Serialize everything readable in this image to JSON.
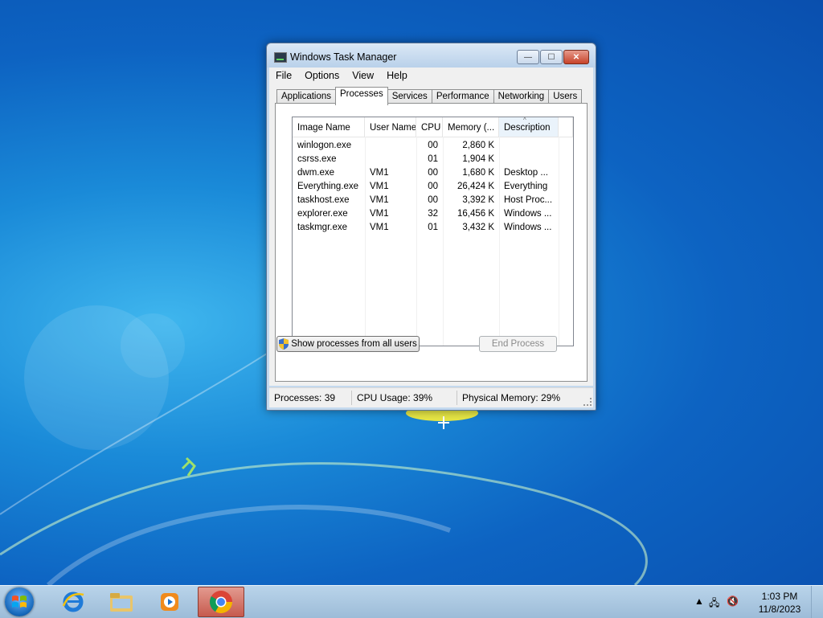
{
  "window": {
    "title": "Windows Task Manager",
    "minimize_glyph": "—",
    "maximize_glyph": "☐",
    "close_glyph": "✕"
  },
  "menu": [
    "File",
    "Options",
    "View",
    "Help"
  ],
  "tabs": [
    "Applications",
    "Processes",
    "Services",
    "Performance",
    "Networking",
    "Users"
  ],
  "active_tab": "Processes",
  "processes": {
    "columns": [
      "Image Name",
      "User Name",
      "CPU",
      "Memory (...",
      "Description"
    ],
    "sorted_column": "Description",
    "rows": [
      {
        "image": "winlogon.exe",
        "user": "",
        "cpu": "00",
        "memory": "2,860 K",
        "description": ""
      },
      {
        "image": "csrss.exe",
        "user": "",
        "cpu": "01",
        "memory": "1,904 K",
        "description": ""
      },
      {
        "image": "dwm.exe",
        "user": "VM1",
        "cpu": "00",
        "memory": "1,680 K",
        "description": "Desktop ..."
      },
      {
        "image": "Everything.exe",
        "user": "VM1",
        "cpu": "00",
        "memory": "26,424 K",
        "description": "Everything"
      },
      {
        "image": "taskhost.exe",
        "user": "VM1",
        "cpu": "00",
        "memory": "3,392 K",
        "description": "Host Proc..."
      },
      {
        "image": "explorer.exe",
        "user": "VM1",
        "cpu": "32",
        "memory": "16,456 K",
        "description": "Windows ..."
      },
      {
        "image": "taskmgr.exe",
        "user": "VM1",
        "cpu": "01",
        "memory": "3,432 K",
        "description": "Windows ..."
      }
    ]
  },
  "buttons": {
    "show_all": "Show processes from all users",
    "end_process": "End Process"
  },
  "status": {
    "processes": "Processes: 39",
    "cpu": "CPU Usage: 39%",
    "memory": "Physical Memory: 29%"
  },
  "taskbar": {
    "apps": [
      "internet-explorer",
      "windows-explorer",
      "media-player",
      "chrome"
    ],
    "active_app": "chrome",
    "time": "1:03 PM",
    "date": "11/8/2023"
  },
  "colors": {
    "accent": "#1a8ad8",
    "close_button": "#c7432a"
  }
}
